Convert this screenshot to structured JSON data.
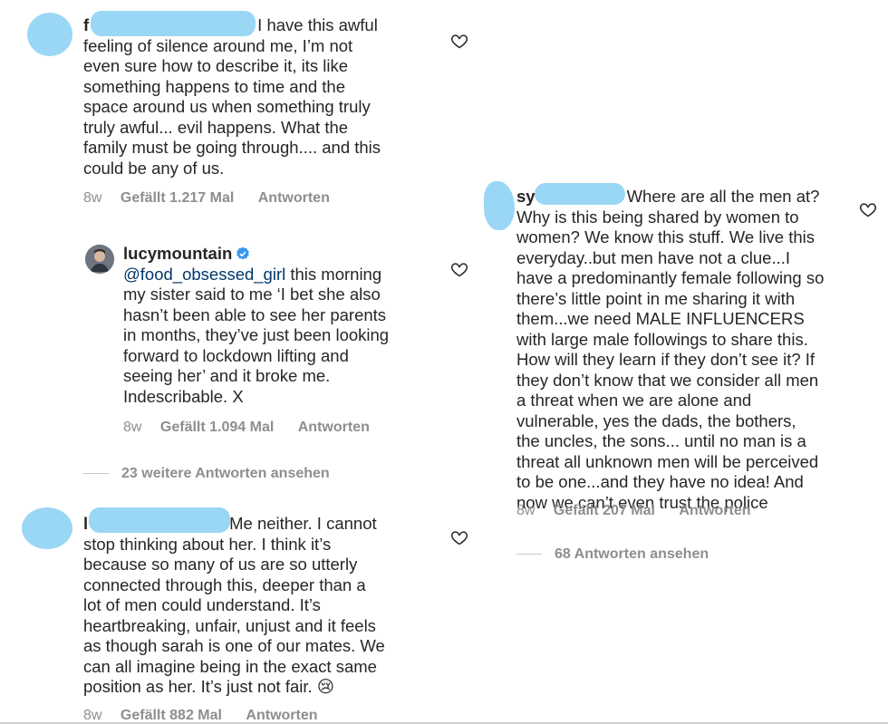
{
  "comments": [
    {
      "prefix": "f",
      "text_lines": [
        "I have this awful",
        "feeling of silence around me, I’m not",
        "even sure how to describe it, its like",
        "something happens to time and the",
        "space around us when something truly",
        "truly awful... evil happens. What the",
        "family must be going through.... and this",
        "could be any of us."
      ],
      "age": "8w",
      "likes": "Gefällt 1.217 Mal",
      "reply": "Antworten"
    },
    {
      "username": "lucymountain",
      "mention": "@food_obsessed_girl",
      "text_lines": [
        " this morning",
        "my sister said to me ‘I bet she also",
        "hasn’t been able to see her parents",
        "in months, they’ve just been looking",
        "forward to lockdown lifting and",
        "seeing her’ and it broke me.",
        "Indescribable. X"
      ],
      "age": "8w",
      "likes": "Gefällt 1.094 Mal",
      "reply": "Antworten",
      "more_replies": "23 weitere Antworten ansehen"
    },
    {
      "prefix": "l",
      "text_lines": [
        "Me neither. I cannot",
        "stop thinking about her. I think it’s",
        "because so many of us are so utterly",
        "connected through this, deeper than a",
        "lot of men could understand. It’s",
        "heartbreaking, unfair, unjust and it feels",
        "as though sarah is one of our mates. We",
        "can all imagine being in the exact same",
        "position as her. It’s just not fair. 😢"
      ],
      "age": "8w",
      "likes": "Gefällt 882 Mal",
      "reply": "Antworten"
    },
    {
      "prefix": "sy",
      "text_lines": [
        "Where are all the men at?",
        "Why is this being shared by women to",
        "women? We know this stuff. We live this",
        "everyday..but men have not a clue...I",
        "have a predominantly female following so",
        "there’s little point in me sharing it with",
        "them...we need MALE INFLUENCERS",
        "with large male followings to share this.",
        "How will they learn if they don’t see it? If",
        "they don’t know that we consider all men",
        "a threat when we are alone and",
        "vulnerable, yes the dads, the bothers,",
        "the uncles, the sons... until no man is a",
        "threat all unknown men will be perceived",
        "to be one...and they have no idea! And",
        "now we can’t even trust the police"
      ],
      "age": "8w",
      "likes": "Gefällt 207 Mal",
      "reply": "Antworten",
      "more_replies": "68 Antworten ansehen"
    }
  ],
  "icons": {
    "like": "heart-outline-icon",
    "verified": "verified-badge-icon"
  },
  "colors": {
    "redaction": "#8fd3f4",
    "meta_text": "#8e8e8e",
    "verified": "#3897f0"
  }
}
